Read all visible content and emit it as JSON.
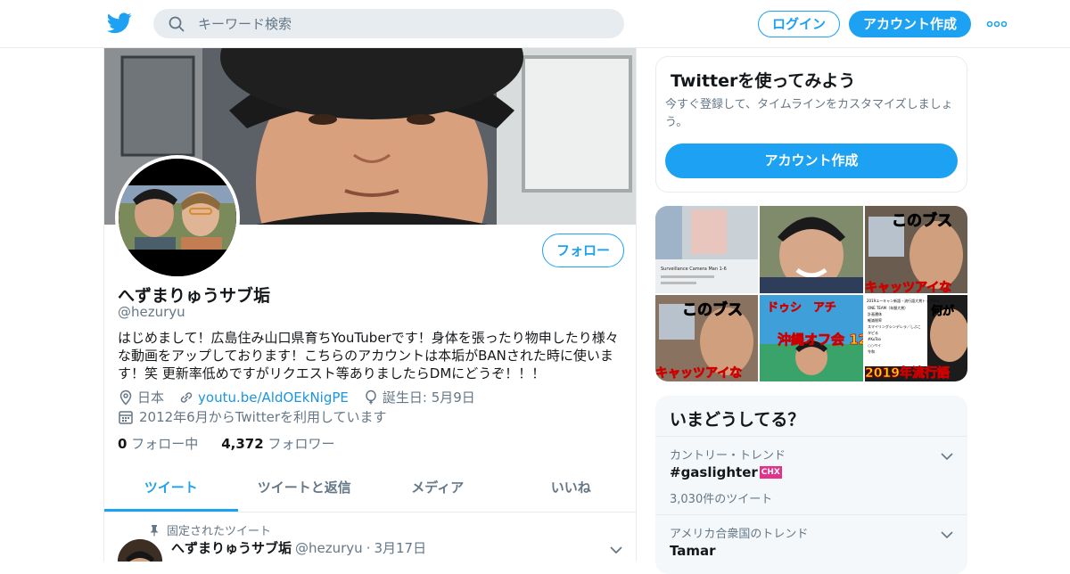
{
  "header": {
    "logo_icon": "twitter-bird-icon",
    "search_placeholder": "キーワード検索",
    "login_label": "ログイン",
    "signup_label": "アカウント作成",
    "more_icon": "more-dots-icon",
    "accent": "#1da1f2"
  },
  "profile": {
    "name": "へずまりゅうサブ垢",
    "handle": "@hezuryu",
    "follow_label": "フォロー",
    "bio": "はじめまして！広島住み山口県育ちYouTuberです！身体を張ったり物申したり様々な動画をアップしております！こちらのアカウントは本垢がBANされた時に使います！笑 更新率低めですがリクエスト等ありましたらDMにどうぞ！！！",
    "location": "日本",
    "website": "youtu.be/AldOEkNigPE",
    "birthday": "誕生日: 5月9日",
    "joined": "2012年6月からTwitterを利用しています",
    "following_count": "0",
    "following_label": "フォロー中",
    "followers_count": "4,372",
    "followers_label": "フォロワー"
  },
  "tabs": [
    {
      "label": "ツイート",
      "active": true
    },
    {
      "label": "ツイートと返信",
      "active": false
    },
    {
      "label": "メディア",
      "active": false
    },
    {
      "label": "いいね",
      "active": false
    }
  ],
  "pinned_tweet": {
    "pinned_label": "固定されたツイート",
    "name": "へずまりゅうサブ垢",
    "handle": "@hezuryu",
    "separator": "·",
    "date": "3月17日"
  },
  "signup_card": {
    "title": "Twitterを使ってみよう",
    "description": "今すぐ登録して、タイムラインをカスタマイズしましょう。",
    "button_label": "アカウント作成"
  },
  "media_grid": {
    "thumbs": [
      {
        "caption": "Surveillance Camera Man 1-6"
      },
      {
        "caption": ""
      },
      {
        "caption": "このブス"
      },
      {
        "caption": "このブス"
      },
      {
        "caption": "沖縄オフ会 12/21"
      },
      {
        "caption": "2019年流行語"
      }
    ],
    "extra_texts": {
      "t3_bottom": "キャッツアイな",
      "t4_bottom": "キャッツアイな",
      "t5_top": "ドゥシ　アチ",
      "t6_top": "何が",
      "t6_list_title": "2019ユーキャン新語・流行語大賞トップテン",
      "t6_list": [
        "ONE TEAM（年間大賞）",
        "計画運休",
        "軽減税率",
        "スマイリングシンデレラ／しぶこ",
        "タピる",
        "#KuToo",
        "○○ペイ",
        "令和"
      ]
    }
  },
  "trends": {
    "title": "いまどうしてる？",
    "items": [
      {
        "context": "カントリー・トレンド",
        "topic": "#gaslighter",
        "badge": "CHX",
        "count": "3,030件のツイート"
      },
      {
        "context": "アメリカ合衆国のトレンド",
        "topic": "Tamar",
        "badge": "",
        "count": ""
      }
    ]
  }
}
